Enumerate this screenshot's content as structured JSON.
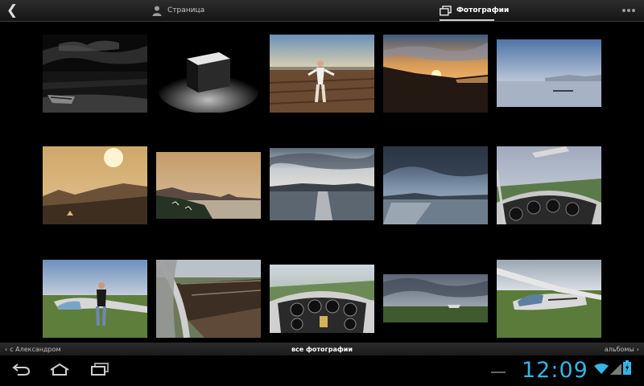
{
  "topbar": {
    "tabs": [
      {
        "label": "Страница",
        "icon": "person-icon",
        "selected": false
      },
      {
        "label": "Фотографии",
        "icon": "photos-icon",
        "selected": true
      }
    ]
  },
  "photos": [
    {
      "name": "photo-night-boat",
      "scene": "night"
    },
    {
      "name": "photo-glowing-cube",
      "scene": "cube"
    },
    {
      "name": "photo-man-field",
      "scene": "field-man"
    },
    {
      "name": "photo-sunset-hills",
      "scene": "sunset"
    },
    {
      "name": "photo-lake-dusk",
      "scene": "lake-blue"
    },
    {
      "name": "photo-hazy-sun-mountains",
      "scene": "haze-sun"
    },
    {
      "name": "photo-coast-town",
      "scene": "coast"
    },
    {
      "name": "photo-lake-sunlight",
      "scene": "lake-light"
    },
    {
      "name": "photo-stormy-lake",
      "scene": "stormy"
    },
    {
      "name": "photo-glider-cockpit-1",
      "scene": "cockpit-a"
    },
    {
      "name": "photo-man-by-glider",
      "scene": "man-glider"
    },
    {
      "name": "photo-aerial-fields",
      "scene": "aerial"
    },
    {
      "name": "photo-glider-cockpit-2",
      "scene": "cockpit-b"
    },
    {
      "name": "photo-cloudy-field",
      "scene": "cloudy"
    },
    {
      "name": "photo-glider-parked",
      "scene": "glider"
    }
  ],
  "navbar": {
    "prev_label": "с Александром",
    "center_label": "все фотографии",
    "next_label": "альбомы"
  },
  "status": {
    "time": "12:09"
  },
  "colors": {
    "accent": "#35b5e5",
    "bar": "#1f1f1f",
    "background": "#000000"
  }
}
